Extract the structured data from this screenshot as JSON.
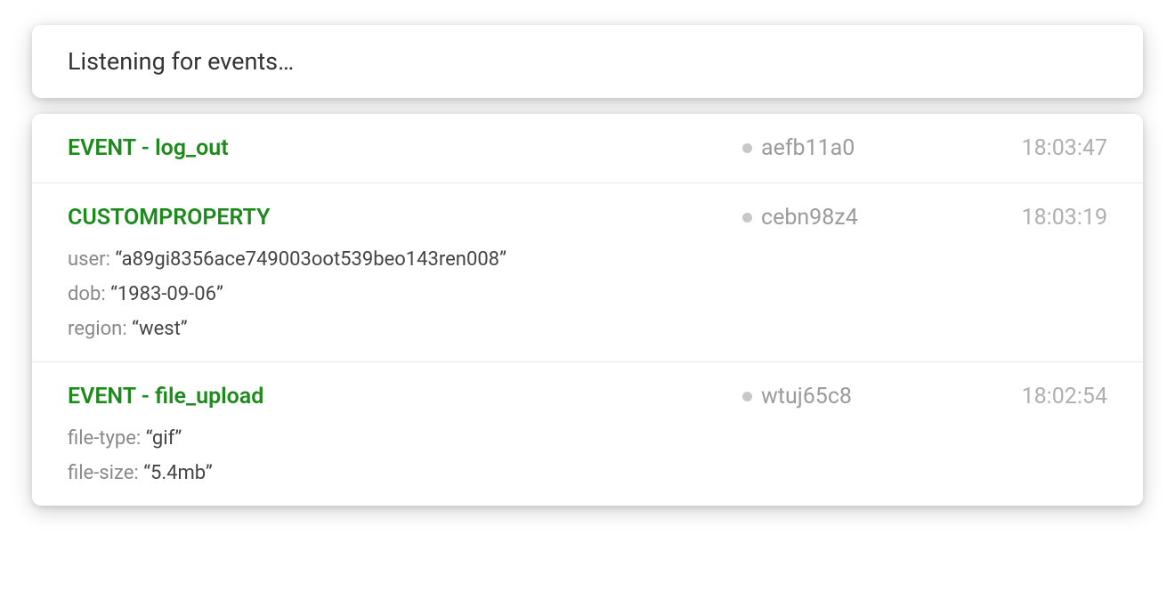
{
  "header": {
    "title": "Listening for events…"
  },
  "events": [
    {
      "title": "EVENT   -   log_out",
      "id": "aefb11a0",
      "time": "18:03:47",
      "props": []
    },
    {
      "title": "CUSTOMPROPERTY",
      "id": "cebn98z4",
      "time": "18:03:19",
      "props": [
        {
          "key": "user",
          "value": "a89gi8356ace749003oot539beo143ren008"
        },
        {
          "key": "dob",
          "value": "1983-09-06"
        },
        {
          "key": "region",
          "value": "west"
        }
      ]
    },
    {
      "title": "EVENT   -   file_upload",
      "id": "wtuj65c8",
      "time": "18:02:54",
      "props": [
        {
          "key": "file-type",
          "value": "gif"
        },
        {
          "key": "file-size",
          "value": "5.4mb"
        }
      ]
    }
  ]
}
